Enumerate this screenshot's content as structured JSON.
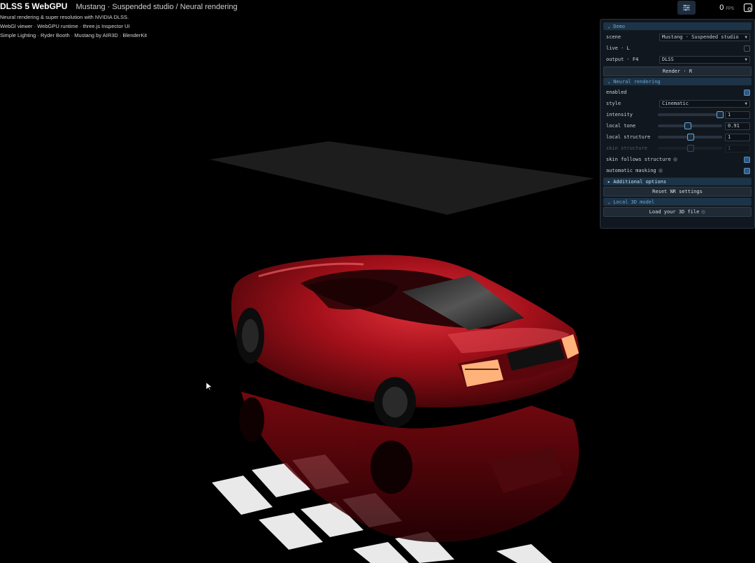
{
  "header": {
    "app_title": "DLSS 5 WebGPU",
    "scene_title": "Mustang · Suspended studio / Neural rendering",
    "lines": [
      "Neural rendering & super resolution with NVIDIA DLSS.",
      "WebGl viewer · WebGPU runtime · three.js Inspector UI",
      "Simple Lighting · Ryder Booth · Mustang by AIR3D · BlenderKit"
    ]
  },
  "toolbar": {
    "fps_value": "0",
    "fps_unit": "FPS",
    "icons": [
      "settings-sliders-icon",
      "screenshot-icon"
    ]
  },
  "panel": {
    "demo": {
      "label": "Demo",
      "scene_label": "scene",
      "scene_value": "Mustang · Suspended studio",
      "live_label": "live · L",
      "output_label": "output · F4",
      "output_value": "DLSS",
      "render_label": "Render · R"
    },
    "neural": {
      "label": "Neural rendering",
      "enabled_label": "enabled",
      "style_label": "style",
      "style_value": "Cinematic",
      "intensity_label": "intensity",
      "intensity_value": "1",
      "local_tone_label": "local tone",
      "local_tone_value": "0.91",
      "local_structure_label": "local structure",
      "local_structure_value": "1",
      "skin_structure_label": "skin structure",
      "skin_structure_value": "1",
      "skin_follows_label": "skin follows structure",
      "auto_masking_label": "automatic masking",
      "additional_label": "Additional options",
      "reset_label": "Reset NR settings"
    },
    "local_model": {
      "label": "Local 3D model",
      "load_label": "Load your 3D file"
    }
  },
  "colors": {
    "accent": "#6aa7d6",
    "car": "#b5121b",
    "taillight": "#ffb27a"
  }
}
